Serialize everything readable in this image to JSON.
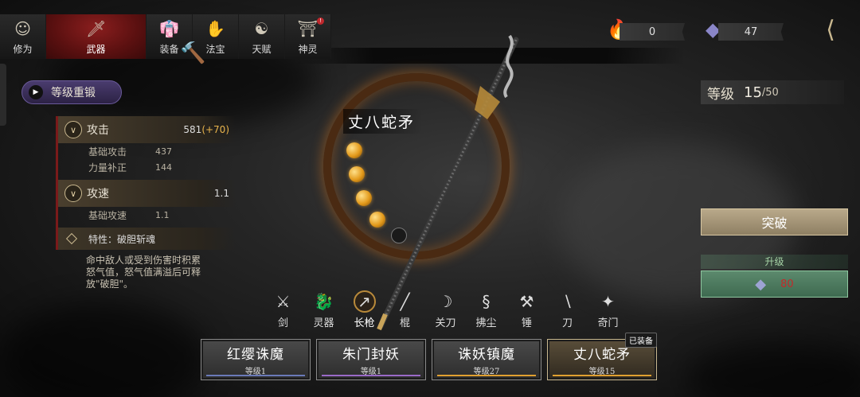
{
  "tabs": [
    {
      "label": "修为",
      "icon": "monk-icon"
    },
    {
      "label": "武器",
      "icon": "sword-icon",
      "active": true
    },
    {
      "label": "装备",
      "icon": "robe-icon"
    },
    {
      "label": "法宝",
      "icon": "gauntlet-icon"
    },
    {
      "label": "天赋",
      "icon": "yinyang-icon"
    },
    {
      "label": "神灵",
      "icon": "tablet-icon",
      "badge": "!"
    }
  ],
  "currencies": [
    {
      "name": "flame-shard",
      "value": "0",
      "color": "#e88a1a"
    },
    {
      "name": "crystal",
      "value": "47",
      "color": "#8a86c8"
    }
  ],
  "reforge_label": "等级重锻",
  "stats": {
    "attack": {
      "label": "攻击",
      "value": "581",
      "bonus": "(+70)",
      "subs": [
        {
          "k": "基础攻击",
          "v": "437"
        },
        {
          "k": "力量补正",
          "v": "144"
        }
      ]
    },
    "speed": {
      "label": "攻速",
      "value": "1.1",
      "subs": [
        {
          "k": "基础攻速",
          "v": "1.1"
        }
      ]
    },
    "trait": "特性：破胆斩魂",
    "description": "命中敌人或受到伤害时积累怒气值，怒气值满溢后可释放\"破胆\"。"
  },
  "weapon_name": "丈八蛇矛",
  "orbs": {
    "filled": 4,
    "total": 5
  },
  "level": {
    "label": "等级",
    "current": "15",
    "max": "/50"
  },
  "breakthrough_label": "突破",
  "upgrade": {
    "label": "升级",
    "cost": "80"
  },
  "weapon_types": [
    {
      "label": "剑",
      "icon": "sword-icon"
    },
    {
      "label": "灵器",
      "icon": "dragon-icon"
    },
    {
      "label": "长枪",
      "icon": "spear-icon",
      "selected": true
    },
    {
      "label": "棍",
      "icon": "staff-icon"
    },
    {
      "label": "关刀",
      "icon": "glaive-icon"
    },
    {
      "label": "拂尘",
      "icon": "whisk-icon"
    },
    {
      "label": "锤",
      "icon": "hammer-icon"
    },
    {
      "label": "刀",
      "icon": "blade-icon"
    },
    {
      "label": "奇门",
      "icon": "qimen-icon"
    }
  ],
  "cards": [
    {
      "name": "红缨诛魔",
      "level": "等级1",
      "color": "#6a7ab8"
    },
    {
      "name": "朱门封妖",
      "level": "等级1",
      "color": "#9a6ac8"
    },
    {
      "name": "诛妖镇魔",
      "level": "等级27",
      "color": "#e0a030"
    },
    {
      "name": "丈八蛇矛",
      "level": "等级15",
      "color": "#e0a030",
      "equipped": "已装备",
      "selected": true
    }
  ]
}
